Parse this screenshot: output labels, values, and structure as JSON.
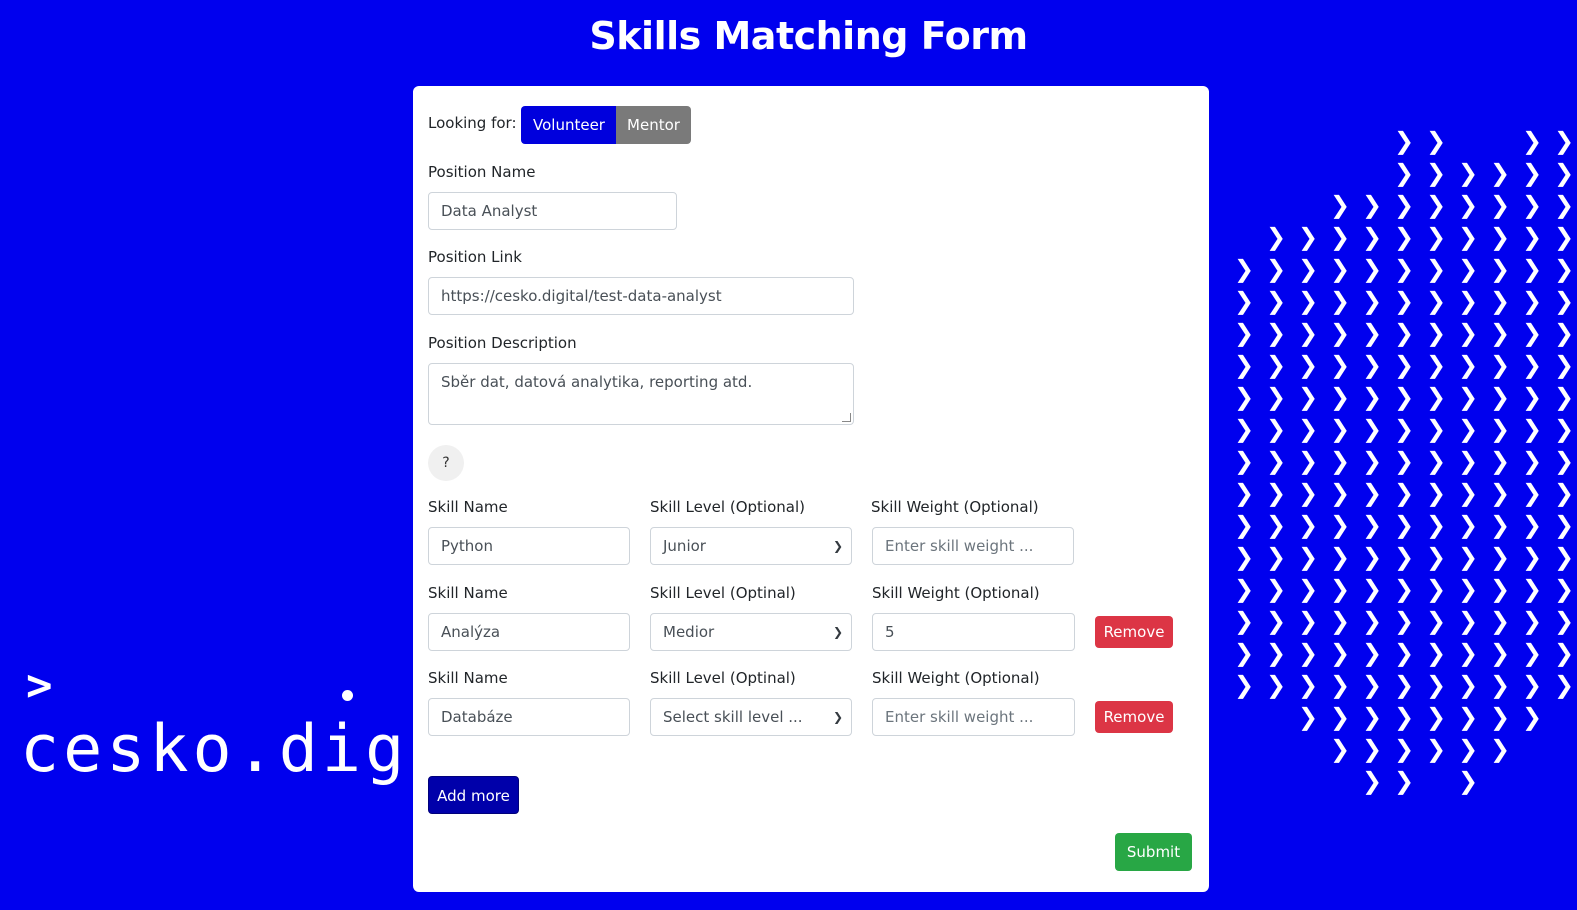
{
  "page": {
    "title": "Skills Matching Form"
  },
  "brand": {
    "text": "cesko.dig"
  },
  "colors": {
    "background": "#0000ee",
    "primary": "#0000dd",
    "secondary": "#7a7a7a",
    "danger": "#dc3545",
    "success": "#28a745",
    "add_more": "#0000aa"
  },
  "form": {
    "looking_for": {
      "label": "Looking for:",
      "options": [
        "Volunteer",
        "Mentor"
      ],
      "selected": "Volunteer"
    },
    "position_name": {
      "label": "Position Name",
      "value": "Data Analyst"
    },
    "position_link": {
      "label": "Position Link",
      "value": "https://cesko.digital/test-data-analyst"
    },
    "position_description": {
      "label": "Position Description",
      "value": "Sběr dat, datová analytika, reporting atd."
    },
    "help_button": "?",
    "skills": [
      {
        "name_label": "Skill Name",
        "name_value": "Python",
        "level_label": "Skill Level (Optional)",
        "level_value": "Junior",
        "weight_label": "Skill Weight (Optional)",
        "weight_value": "",
        "weight_placeholder": "Enter skill weight ...",
        "removable": false
      },
      {
        "name_label": "Skill Name",
        "name_value": "Analýza",
        "level_label": "Skill Level (Optinal)",
        "level_value": "Medior",
        "weight_label": "Skill Weight (Optional)",
        "weight_value": "5",
        "weight_placeholder": "Enter skill weight ...",
        "removable": true,
        "remove_label": "Remove"
      },
      {
        "name_label": "Skill Name",
        "name_value": "Databáze",
        "level_label": "Skill Level (Optinal)",
        "level_value": "Select skill level ...",
        "weight_label": "Skill Weight (Optional)",
        "weight_value": "",
        "weight_placeholder": "Enter skill weight ...",
        "removable": true,
        "remove_label": "Remove"
      }
    ],
    "add_more_label": "Add more",
    "submit_label": "Submit"
  }
}
